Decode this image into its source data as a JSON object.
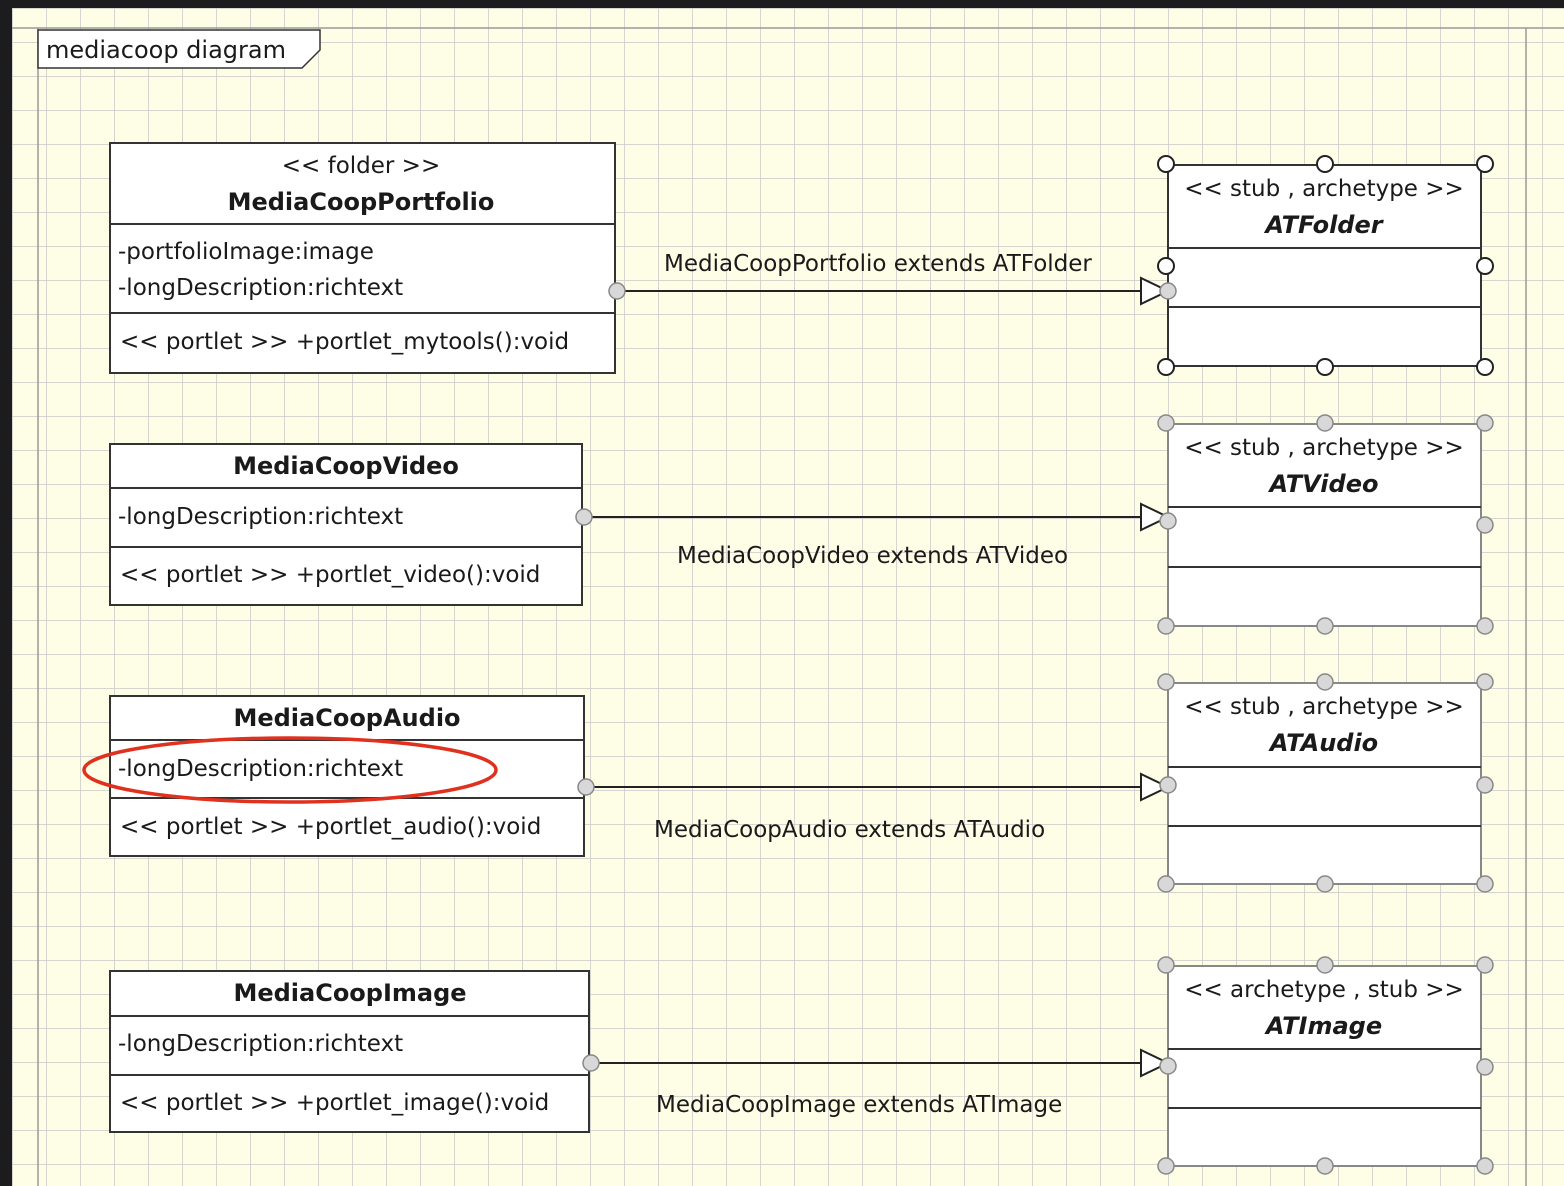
{
  "diagram": {
    "frame_label": "mediacoop diagram",
    "highlight_color": "#e0301e",
    "grid_color": "#c8c8c8",
    "canvas_color": "#fefde6"
  },
  "classes": [
    {
      "stereotype": "<< folder >>",
      "name": "MediaCoopPortfolio",
      "attributes": [
        "-portfolioImage:image",
        "-longDescription:richtext"
      ],
      "operations": [
        "<< portlet >> +portlet_mytools():void"
      ]
    },
    {
      "stereotype": "",
      "name": "MediaCoopVideo",
      "attributes": [
        "-longDescription:richtext"
      ],
      "operations": [
        "<< portlet >> +portlet_video():void"
      ]
    },
    {
      "stereotype": "",
      "name": "MediaCoopAudio",
      "attributes": [
        "-longDescription:richtext"
      ],
      "operations": [
        "<< portlet >> +portlet_audio():void"
      ]
    },
    {
      "stereotype": "",
      "name": "MediaCoopImage",
      "attributes": [
        "-longDescription:richtext"
      ],
      "operations": [
        "<< portlet >> +portlet_image():void"
      ]
    }
  ],
  "stubs": [
    {
      "stereotype": "<< stub , archetype >>",
      "name": "ATFolder"
    },
    {
      "stereotype": "<< stub , archetype >>",
      "name": "ATVideo"
    },
    {
      "stereotype": "<< stub , archetype >>",
      "name": "ATAudio"
    },
    {
      "stereotype": "<< archetype , stub >>",
      "name": "ATImage"
    }
  ],
  "relations": [
    {
      "label": "MediaCoopPortfolio extends ATFolder"
    },
    {
      "label": "MediaCoopVideo extends ATVideo"
    },
    {
      "label": "MediaCoopAudio extends ATAudio"
    },
    {
      "label": "MediaCoopImage extends ATImage"
    }
  ]
}
